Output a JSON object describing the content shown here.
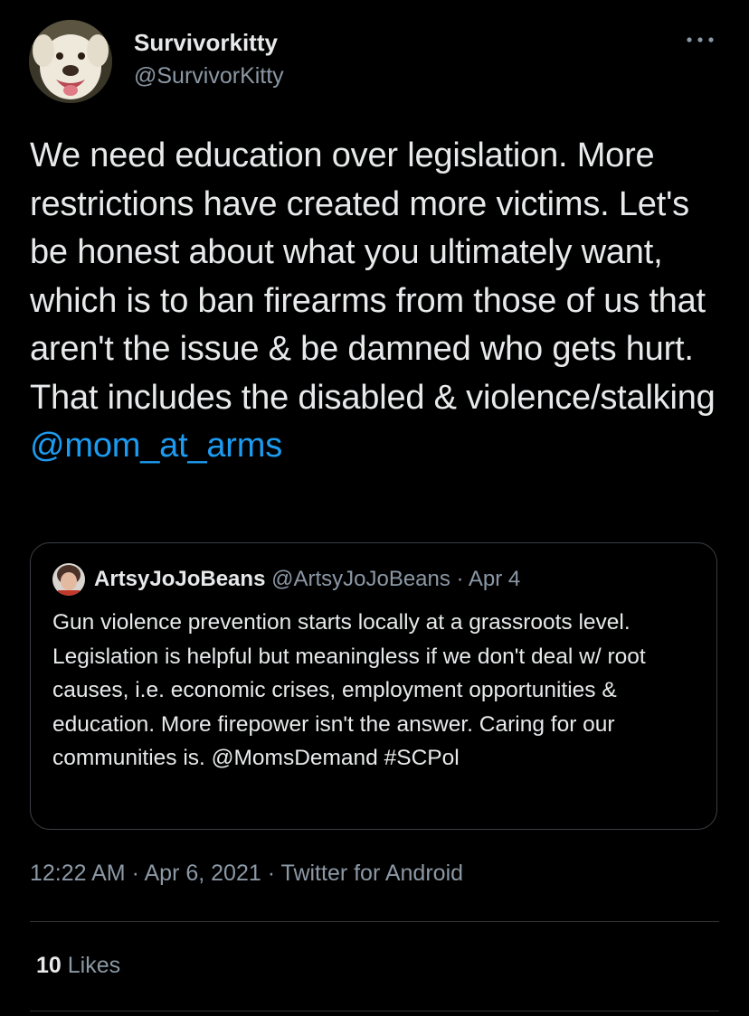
{
  "author": {
    "display_name": "Survivorkitty",
    "handle": "@SurvivorKitty",
    "avatar_icon": "dog-photo-avatar"
  },
  "more_icon": "ellipsis-icon",
  "tweet": {
    "text": "We need education over legislation. More restrictions have created more victims. Let's be honest about what you ultimately want, which is to ban firearms from those of us that aren't the issue & be damned who gets hurt. That includes the disabled & violence/stalking",
    "mention": "@mom_at_arms",
    "mention_color": "#1d9bf0"
  },
  "quote": {
    "display_name": "ArtsyJoJoBeans",
    "handle": "@ArtsyJoJoBeans",
    "separator": "·",
    "date": "Apr 4",
    "avatar_icon": "person-photo-avatar",
    "text": "Gun violence prevention starts locally at a grassroots level. Legislation is helpful but meaningless if we don't deal w/ root causes, i.e. economic crises, employment opportunities & education. More firepower isn't the answer. Caring for our communities is. @MomsDemand #SCPol"
  },
  "meta": {
    "time": "12:22 AM",
    "separator": "·",
    "date": "Apr 6, 2021",
    "source": "Twitter for Android"
  },
  "stats": {
    "likes_count": "10",
    "likes_label": "Likes"
  },
  "colors": {
    "background": "#000000",
    "text_primary": "#e7e9ea",
    "text_secondary": "#8b98a5",
    "accent": "#1d9bf0",
    "border": "#3b3f44"
  }
}
